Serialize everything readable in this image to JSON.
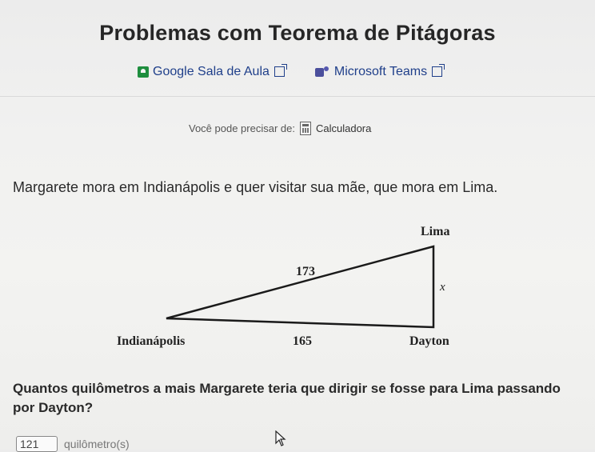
{
  "title": "Problemas com Teorema de Pitágoras",
  "links": {
    "google_classroom": "Google Sala de Aula",
    "microsoft_teams": "Microsoft Teams"
  },
  "calculator": {
    "prompt": "Você pode precisar de:",
    "link": "Calculadora"
  },
  "problem": "Margarete mora em Indianápolis e quer visitar sua mãe, que mora em Lima.",
  "diagram": {
    "vertex_top": "Lima",
    "vertex_left": "Indianápolis",
    "vertex_right": "Dayton",
    "hypotenuse": "173",
    "base": "165",
    "leg": "x"
  },
  "question": "Quantos quilômetros a mais Margarete teria que dirigir se fosse para Lima passando por Dayton?",
  "answer": {
    "value": "121",
    "unit": "quilômetro(s)"
  },
  "colors": {
    "link": "#1f3f8a",
    "text": "#2a2a2a",
    "google_classroom_icon": "#1e8e3e",
    "teams_icon": "#4b4f9c"
  },
  "icons": [
    "google-classroom-icon",
    "external-link-icon",
    "microsoft-teams-icon",
    "calculator-icon",
    "mouse-cursor-icon"
  ]
}
